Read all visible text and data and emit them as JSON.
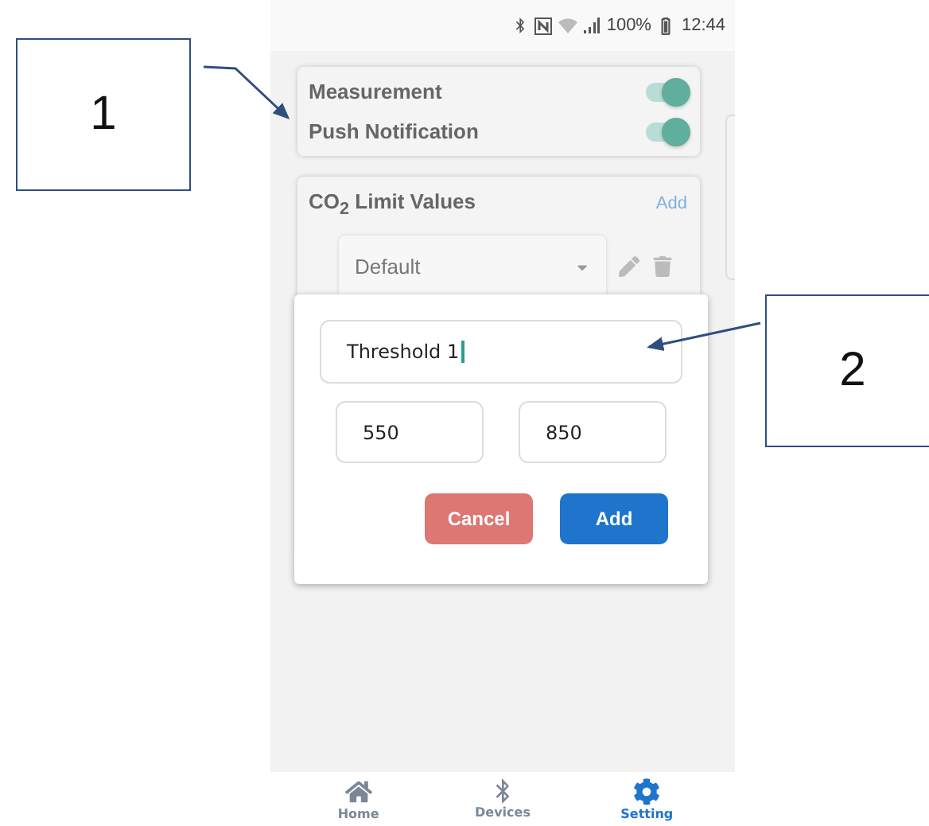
{
  "callouts": [
    {
      "label": "1"
    },
    {
      "label": "2"
    }
  ],
  "status_bar": {
    "battery": "100%",
    "time": "12:44"
  },
  "toggles": [
    {
      "label": "Measurement",
      "on": true
    },
    {
      "label": "Push Notification",
      "on": true
    }
  ],
  "limits": {
    "title": "CO$_{2}$ Limit Values",
    "add": "Add",
    "select_value": "Default"
  },
  "dialog": {
    "name_value": "Threshold 1",
    "low_value": "550",
    "high_value": "850",
    "buttons": [
      {
        "label": "Cancel",
        "kind": "cancel"
      },
      {
        "label": "Add",
        "kind": "primary"
      }
    ]
  },
  "nav": [
    {
      "label": "Home",
      "kind": "home",
      "selected": false
    },
    {
      "label": "Devices",
      "kind": "devices",
      "selected": false
    },
    {
      "label": "Setting",
      "kind": "setting",
      "selected": true
    }
  ]
}
